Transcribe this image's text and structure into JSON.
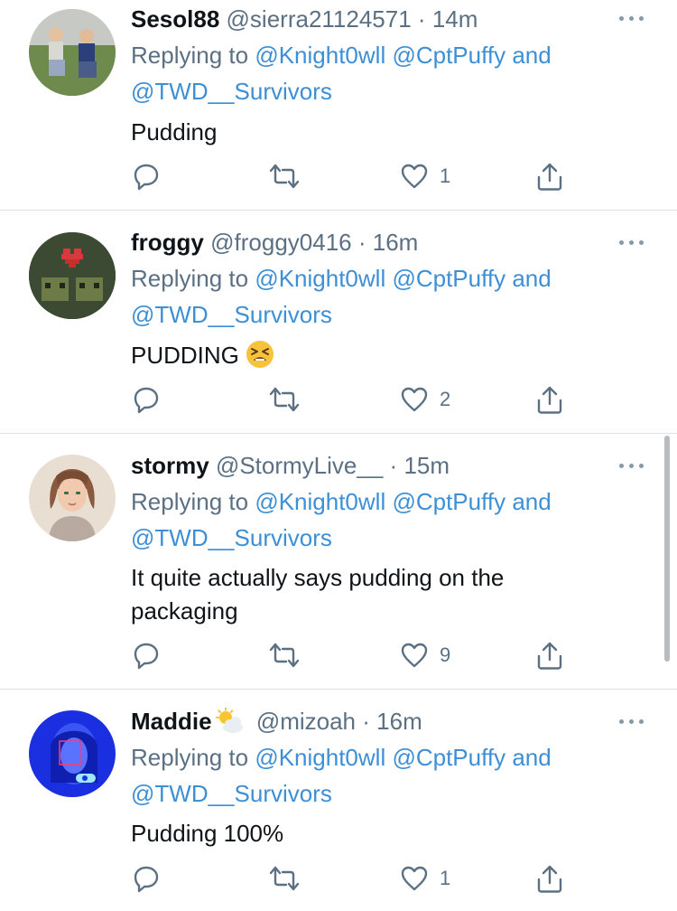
{
  "colors": {
    "link": "#3d8fd6",
    "muted": "#5b7083",
    "text": "#0f1419",
    "divider": "#dfe3e6"
  },
  "tweets": [
    {
      "name": "Sesol88",
      "handle": "@sierra21124571",
      "sep": "·",
      "time": "14m",
      "replying_prefix": "Replying to",
      "mention1": "@Knight0wll",
      "mention2": "@CptPuffy",
      "and": "and",
      "mention3": "@TWD__Survivors",
      "text": "Pudding",
      "likes": "1",
      "avatar_icon": "photo-two-kids-icon"
    },
    {
      "name": "froggy",
      "handle": "@froggy0416",
      "sep": "·",
      "time": "16m",
      "replying_prefix": "Replying to",
      "mention1": "@Knight0wll",
      "mention2": "@CptPuffy",
      "and": "and",
      "mention3": "@TWD__Survivors",
      "text": "PUDDING",
      "text_emoji": "tired-face-emoji",
      "likes": "2",
      "avatar_icon": "pixel-frogs-heart-icon"
    },
    {
      "name": "stormy",
      "handle": "@StormyLive__",
      "sep": "·",
      "time": "15m",
      "replying_prefix": "Replying to",
      "mention1": "@Knight0wll",
      "mention2": "@CptPuffy",
      "and": "and",
      "mention3": "@TWD__Survivors",
      "text_line1": "It quite actually says pudding on the",
      "text_line2": "packaging",
      "likes": "9",
      "avatar_icon": "drawn-girl-icon"
    },
    {
      "name": "Maddie",
      "name_emoji": "sun-behind-cloud-emoji",
      "handle": "@mizoah",
      "sep": "·",
      "time": "16m",
      "replying_prefix": "Replying to",
      "mention1": "@Knight0wll",
      "mention2": "@CptPuffy",
      "and": "and",
      "mention3": "@TWD__Survivors",
      "text": "Pudding 100%",
      "likes": "1",
      "avatar_icon": "blue-selfie-icon"
    }
  ]
}
